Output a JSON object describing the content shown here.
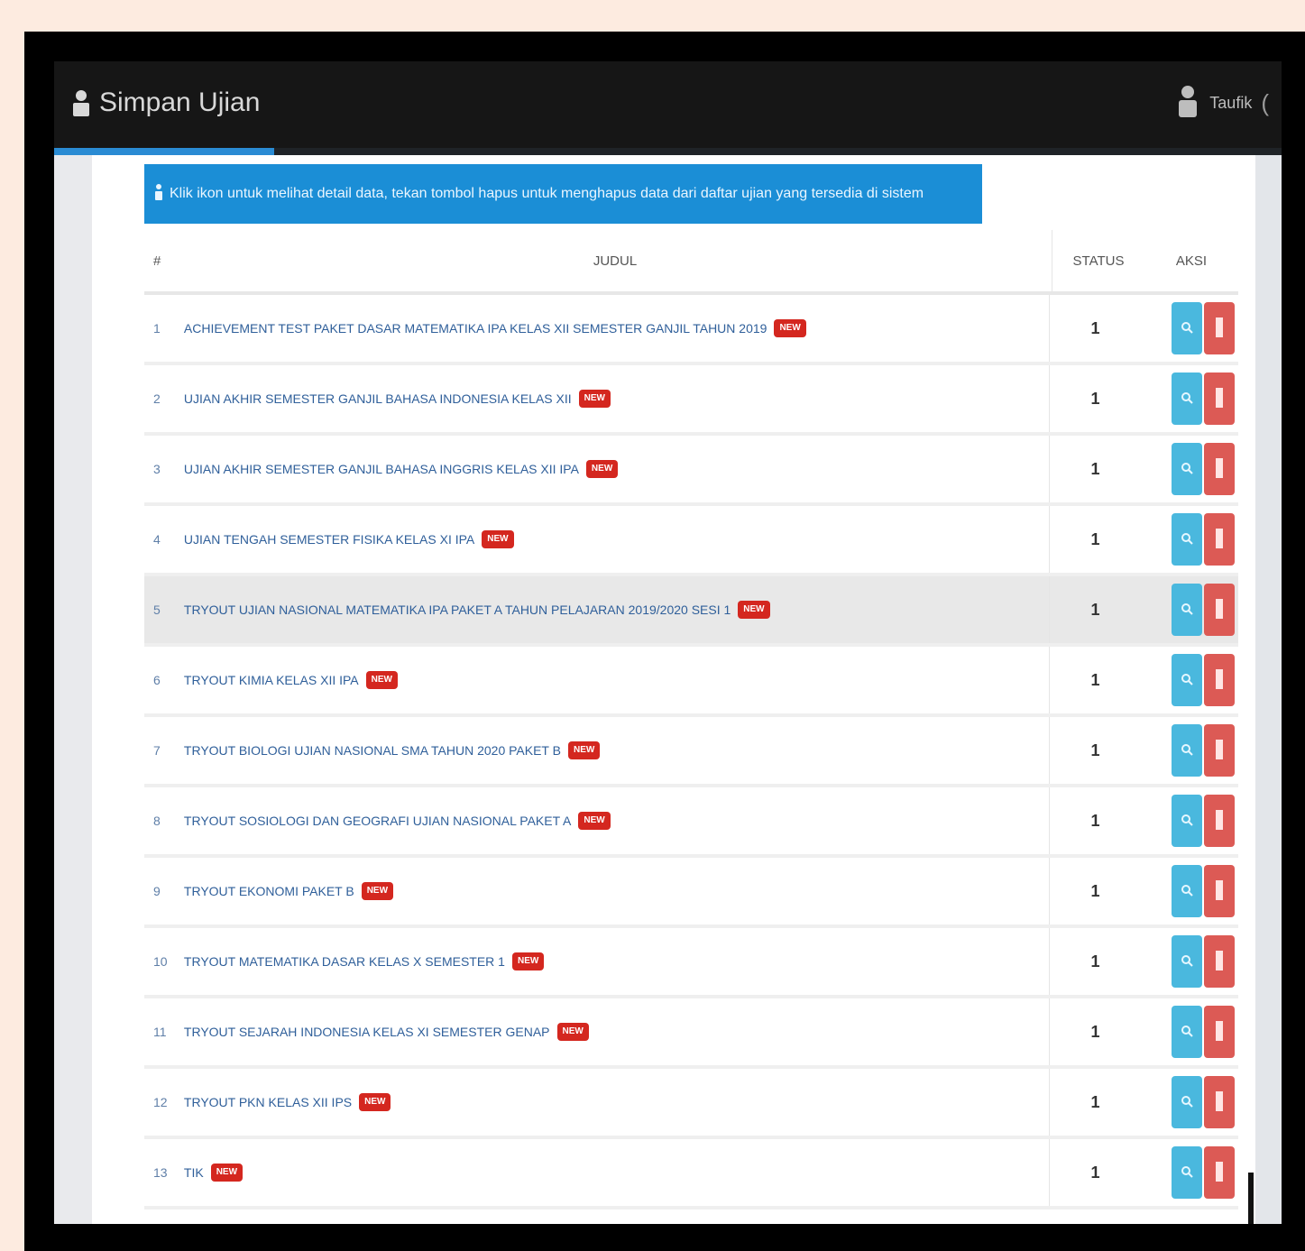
{
  "app": {
    "brand": "Simpan Ujian",
    "user_label": "Taufik",
    "accent_color": "#2a8bd3"
  },
  "alert": {
    "text": "Klik ikon untuk melihat detail data, tekan tombol hapus untuk menghapus data dari daftar ujian yang tersedia di sistem"
  },
  "table": {
    "headers": {
      "no": "#",
      "nama": "JUDUL",
      "status": "STATUS",
      "aksi": "AKSI"
    },
    "rows": [
      {
        "no": "1",
        "nama": "ACHIEVEMENT TEST PAKET DASAR MATEMATIKA IPA KELAS XII SEMESTER GANJIL TAHUN 2019",
        "badge": "NEW",
        "status": "1"
      },
      {
        "no": "2",
        "nama": "UJIAN AKHIR SEMESTER GANJIL BAHASA INDONESIA KELAS XII",
        "badge": "NEW",
        "status": "1"
      },
      {
        "no": "3",
        "nama": "UJIAN AKHIR SEMESTER GANJIL BAHASA INGGRIS KELAS XII IPA",
        "badge": "NEW",
        "status": "1"
      },
      {
        "no": "4",
        "nama": "UJIAN TENGAH SEMESTER FISIKA KELAS XI IPA",
        "badge": "NEW",
        "status": "1"
      },
      {
        "no": "5",
        "nama": "TRYOUT UJIAN NASIONAL MATEMATIKA IPA PAKET A TAHUN PELAJARAN 2019/2020 SESI 1",
        "badge": "NEW",
        "status": "1"
      },
      {
        "no": "6",
        "nama": "TRYOUT KIMIA KELAS XII IPA",
        "badge": "NEW",
        "status": "1"
      },
      {
        "no": "7",
        "nama": "TRYOUT BIOLOGI UJIAN NASIONAL SMA TAHUN 2020 PAKET B",
        "badge": "NEW",
        "status": "1"
      },
      {
        "no": "8",
        "nama": "TRYOUT SOSIOLOGI DAN GEOGRAFI UJIAN NASIONAL PAKET A",
        "badge": "NEW",
        "status": "1"
      },
      {
        "no": "9",
        "nama": "TRYOUT EKONOMI PAKET B",
        "badge": "NEW",
        "status": "1"
      },
      {
        "no": "10",
        "nama": "TRYOUT MATEMATIKA DASAR KELAS X SEMESTER 1",
        "badge": "NEW",
        "status": "1"
      },
      {
        "no": "11",
        "nama": "TRYOUT SEJARAH INDONESIA KELAS XI SEMESTER GENAP",
        "badge": "NEW",
        "status": "1"
      },
      {
        "no": "12",
        "nama": "TRYOUT PKN KELAS XII IPS",
        "badge": "NEW",
        "status": "1"
      },
      {
        "no": "13",
        "nama": "TIK",
        "badge": "NEW",
        "status": "1"
      }
    ]
  },
  "icons": {
    "brand": "user-icon",
    "user": "user-icon",
    "alert": "info-icon",
    "view": "search-icon",
    "delete": "trash-icon"
  }
}
